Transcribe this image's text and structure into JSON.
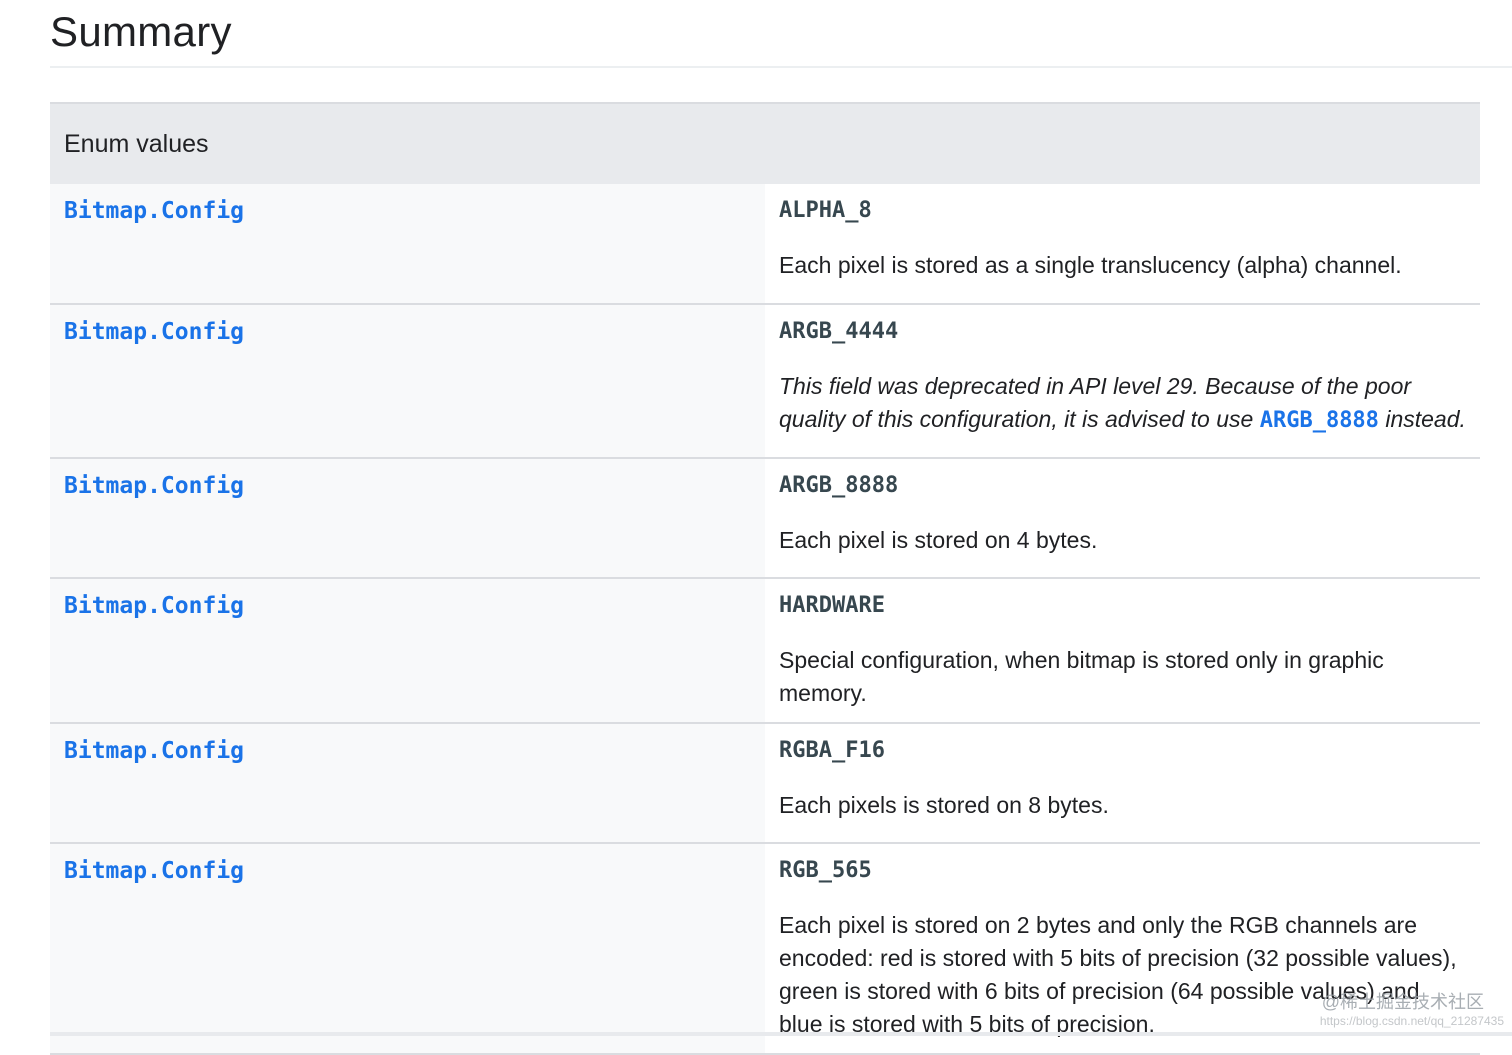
{
  "page": {
    "title": "Summary"
  },
  "table": {
    "header": "Enum values",
    "rows": [
      {
        "type": "Bitmap.Config",
        "name": "ALPHA_8",
        "description": "Each pixel is stored as a single translucency (alpha) channel."
      },
      {
        "type": "Bitmap.Config",
        "name": "ARGB_4444",
        "description_before": "This field was deprecated in API level 29. Because of the poor quality of this configuration, it is advised to use ",
        "description_link": "ARGB_8888",
        "description_after": " instead."
      },
      {
        "type": "Bitmap.Config",
        "name": "ARGB_8888",
        "description": "Each pixel is stored on 4 bytes."
      },
      {
        "type": "Bitmap.Config",
        "name": "HARDWARE",
        "description": "Special configuration, when bitmap is stored only in graphic memory."
      },
      {
        "type": "Bitmap.Config",
        "name": "RGBA_F16",
        "description": "Each pixels is stored on 8 bytes."
      },
      {
        "type": "Bitmap.Config",
        "name": "RGB_565",
        "description": "Each pixel is stored on 2 bytes and only the RGB channels are encoded: red is stored with 5 bits of precision (32 possible values), green is stored with 6 bits of precision (64 possible values) and blue is stored with 5 bits of precision."
      }
    ]
  },
  "watermark": {
    "text": "@稀土掘金技术社区",
    "url": "https://blog.csdn.net/qq_21287435"
  },
  "colors": {
    "link": "#1a73e8",
    "header_bg": "#e8eaed",
    "type_cell_bg": "#f8f9fa",
    "border": "#dadce0"
  }
}
